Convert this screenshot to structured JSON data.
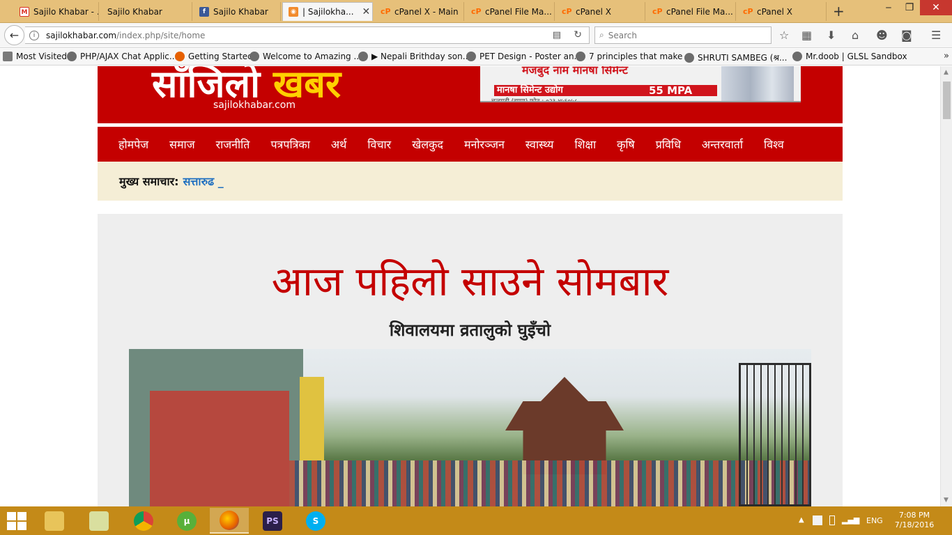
{
  "browser": {
    "tabs": [
      {
        "label": "Sajilo Khabar - ...",
        "icon": "gmail-icon",
        "active": false
      },
      {
        "label": "Sajilo Khabar",
        "icon": "none",
        "active": false
      },
      {
        "label": "Sajilo Khabar",
        "icon": "facebook-icon",
        "active": false
      },
      {
        "label": "| Sajilokha...",
        "icon": "rss-icon",
        "active": true
      },
      {
        "label": "cPanel X - Main",
        "icon": "cpanel-icon",
        "active": false
      },
      {
        "label": "cPanel File Ma...",
        "icon": "cpanel-icon",
        "active": false
      },
      {
        "label": "cPanel X",
        "icon": "cpanel-icon",
        "active": false
      },
      {
        "label": "cPanel File Ma...",
        "icon": "cpanel-icon",
        "active": false
      },
      {
        "label": "cPanel X",
        "icon": "cpanel-icon",
        "active": false
      }
    ],
    "url_host": "sajilokhabar.com",
    "url_path": "/index.php/site/home",
    "search_placeholder": "Search",
    "bookmarks": [
      {
        "label": "Most Visited"
      },
      {
        "label": "PHP/AJAX Chat Applic..."
      },
      {
        "label": "Getting Started"
      },
      {
        "label": "Welcome to Amazing ..."
      },
      {
        "label": "▶ Nepali Brithday son..."
      },
      {
        "label": "PET Design - Poster an..."
      },
      {
        "label": "7 principles that make ..."
      },
      {
        "label": "SHRUTI SAMBEG (श्र..."
      },
      {
        "label": "Mr.doob | GLSL Sandbox"
      }
    ]
  },
  "site": {
    "logo_text_white": "साँजिलो ",
    "logo_text_yellow": "खबर",
    "logo_domain": "sajilokhabar.com",
    "ad": {
      "line1": "मजबुद नाम  मानषा सिमेन्ट",
      "line2": "मानषा सिमेन्ट उद्योग",
      "strength": "55 MPA",
      "line3": "चन्द्रगढी (झापा) फोन : ०२३-४५६०५८"
    },
    "nav": [
      "होमपेज",
      "समाज",
      "राजनीति",
      "पत्रपत्रिका",
      "अर्थ",
      "विचार",
      "खेलकुद",
      "मनोरञ्जन",
      "स्वास्थ्य",
      "शिक्षा",
      "कृषि",
      "प्रविधि",
      "अन्तरवार्ता",
      "विश्व"
    ],
    "ticker_label": "मुख्य समाचार:",
    "ticker_link": "सत्तारुढ _",
    "feature": {
      "headline": "आज पहिलो साउने सोमबार",
      "subheadline": "शिवालयमा व्रतालुको घुइँचो"
    }
  },
  "taskbar": {
    "apps": [
      "file-explorer",
      "windows-explorer",
      "chrome",
      "utorrent",
      "firefox",
      "photoshop",
      "skype"
    ],
    "lang": "ENG",
    "time": "7:08 PM",
    "date": "7/18/2016"
  },
  "colors": {
    "brand_red": "#c40000",
    "ticker_bg": "#f5eed6",
    "link_blue": "#1e6fc0",
    "taskbar": "#c48a18"
  }
}
